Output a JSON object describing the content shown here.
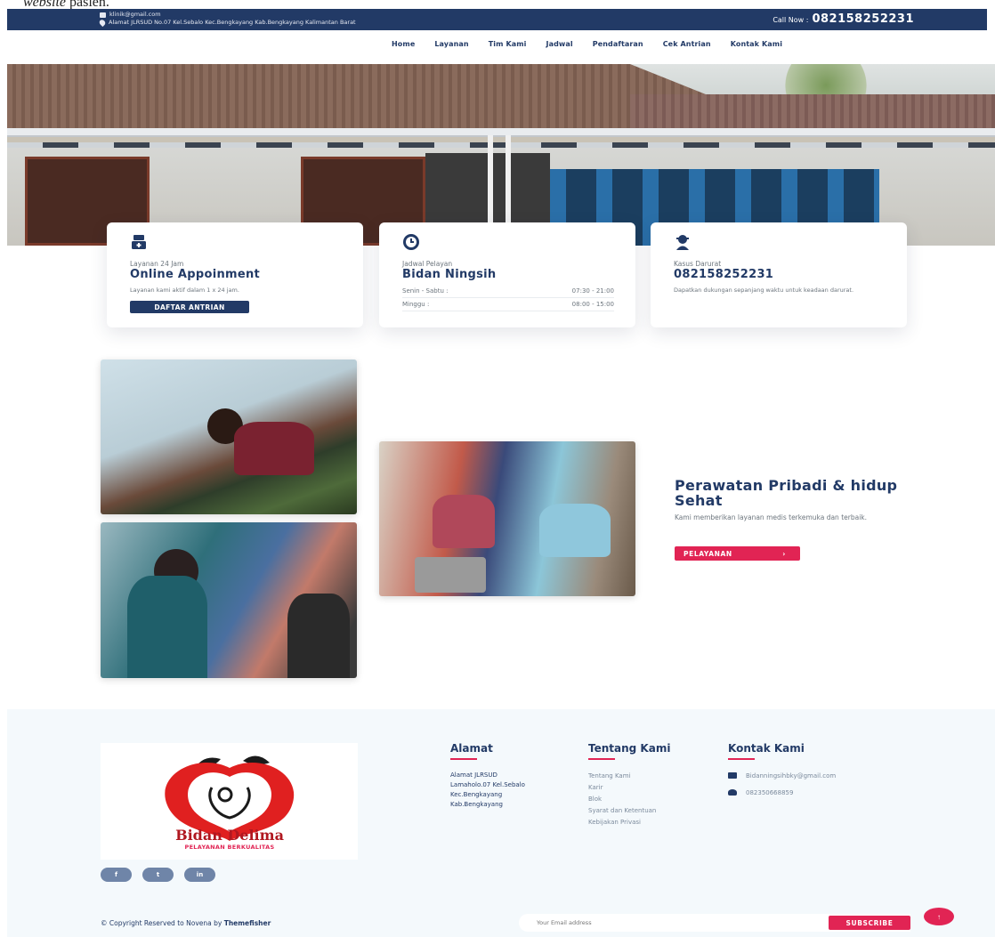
{
  "caption": {
    "word_italic": "website",
    "word_rest": " pasien."
  },
  "topbar": {
    "email": "klinik@gmail.com",
    "address": "Alamat JLRSUD No.07 Kel.Sebalo Kec.Bengkayang Kab.Bengkayang Kalimantan Barat",
    "call_label": "Call Now :",
    "call_number": "082158252231"
  },
  "nav": {
    "items": [
      "Home",
      "Layanan",
      "Tim Kami",
      "Jadwal",
      "Pendaftaran",
      "Cek Antrian",
      "Kontak Kami"
    ]
  },
  "cards": {
    "appointment": {
      "small": "Layanan 24 Jam",
      "title": "Online Appoinment",
      "desc": "Layanan kami aktif dalam 1 x 24 jam.",
      "button": "DAFTAR ANTRIAN",
      "icon": "ambulance-icon"
    },
    "schedule": {
      "small": "Jadwal Pelayan",
      "title": "Bidan Ningsih",
      "rows": [
        {
          "day": "Senin - Sabtu :",
          "time": "07:30 - 21:00"
        },
        {
          "day": "Minggu :",
          "time": "08:00 - 15:00"
        }
      ],
      "icon": "clock-icon"
    },
    "emergency": {
      "small": "Kasus Darurat",
      "title": "082158252231",
      "desc": "Dapatkan dukungan sepanjang waktu untuk keadaan darurat.",
      "icon": "headset-icon"
    }
  },
  "promo": {
    "title": "Perawatan Pribadi & hidup Sehat",
    "text": "Kami memberikan layanan medis terkemuka dan terbaik.",
    "button": "PELAYANAN",
    "button_arrow": "›"
  },
  "footer": {
    "logo_name": "Bidan Delima",
    "logo_tagline": "PELAYANAN BERKUALITAS",
    "social": [
      "f",
      "t",
      "in"
    ],
    "address": {
      "title": "Alamat",
      "lines": [
        "Alamat JLRSUD",
        "Lamaholo.07 Kel.Sebalo",
        "Kec.Bengkayang",
        "Kab.Bengkayang"
      ]
    },
    "about": {
      "title": "Tentang Kami",
      "links": [
        "Tentang Kami",
        "Karir",
        "Blok",
        "Syarat dan Ketentuan",
        "Kebijakan Privasi"
      ]
    },
    "contact": {
      "title": "Kontak Kami",
      "email": "Bidanningsihbky@gmail.com",
      "phone": "082350668859"
    },
    "copyright_text": "© Copyright Reserved to Novena by ",
    "copyright_brand": "Themefisher",
    "newsletter_placeholder": "Your Email address",
    "subscribe": "SUBSCRIBE",
    "to_top": "↑"
  },
  "colors": {
    "primary": "#223a66",
    "accent": "#e12454",
    "footer_bg": "#f4f9fc"
  }
}
